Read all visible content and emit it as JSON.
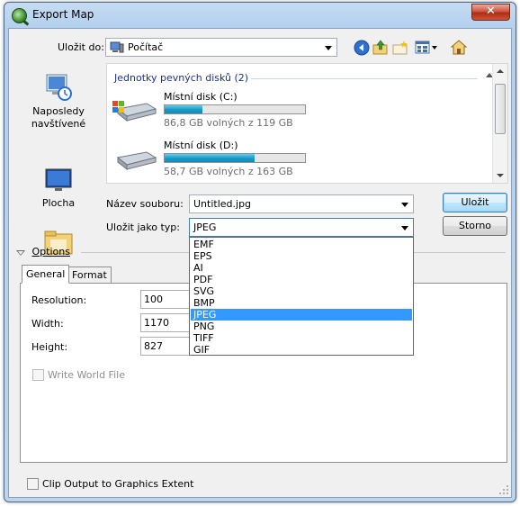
{
  "window": {
    "title": "Export Map",
    "close_glyph": "✕"
  },
  "save_in": {
    "label": "Uložit do:",
    "value": "Počítač"
  },
  "toolbar": {
    "icons": [
      "back-icon",
      "up-folder-icon",
      "new-folder-icon",
      "view-menu-icon",
      "home-icon"
    ]
  },
  "places": [
    {
      "name": "recent-places",
      "label": "Naposledy navštívené"
    },
    {
      "name": "desktop",
      "label": "Plocha"
    }
  ],
  "browser": {
    "group_header": "Jednotky pevných disků (2)",
    "drives": [
      {
        "name": "Místní disk (C:)",
        "free": "86,8 GB volných z 119 GB",
        "used_fraction": 0.27
      },
      {
        "name": "Místní disk (D:)",
        "free": "58,7 GB volných z 163 GB",
        "used_fraction": 0.64
      }
    ]
  },
  "filename": {
    "label": "Název souboru:",
    "value": "Untitled.jpg"
  },
  "filetype": {
    "label": "Uložit jako typ:",
    "value": "JPEG",
    "options": [
      "EMF",
      "EPS",
      "AI",
      "PDF",
      "SVG",
      "BMP",
      "JPEG",
      "PNG",
      "TIFF",
      "GIF"
    ],
    "selected_index": 6
  },
  "buttons": {
    "save": "Uložit",
    "cancel": "Storno"
  },
  "options": {
    "header": "Options",
    "tabs": [
      "General",
      "Format"
    ],
    "fields": [
      {
        "label": "Resolution:",
        "value": "100"
      },
      {
        "label": "Width:",
        "value": "1170"
      },
      {
        "label": "Height:",
        "value": "827"
      }
    ],
    "world_file": "Write World File"
  },
  "clip": {
    "label": "Clip Output to Graphics Extent"
  },
  "colors": {
    "selection": "#3399ff",
    "progress": "#1e9bc9",
    "group_header": "#1e3287"
  }
}
